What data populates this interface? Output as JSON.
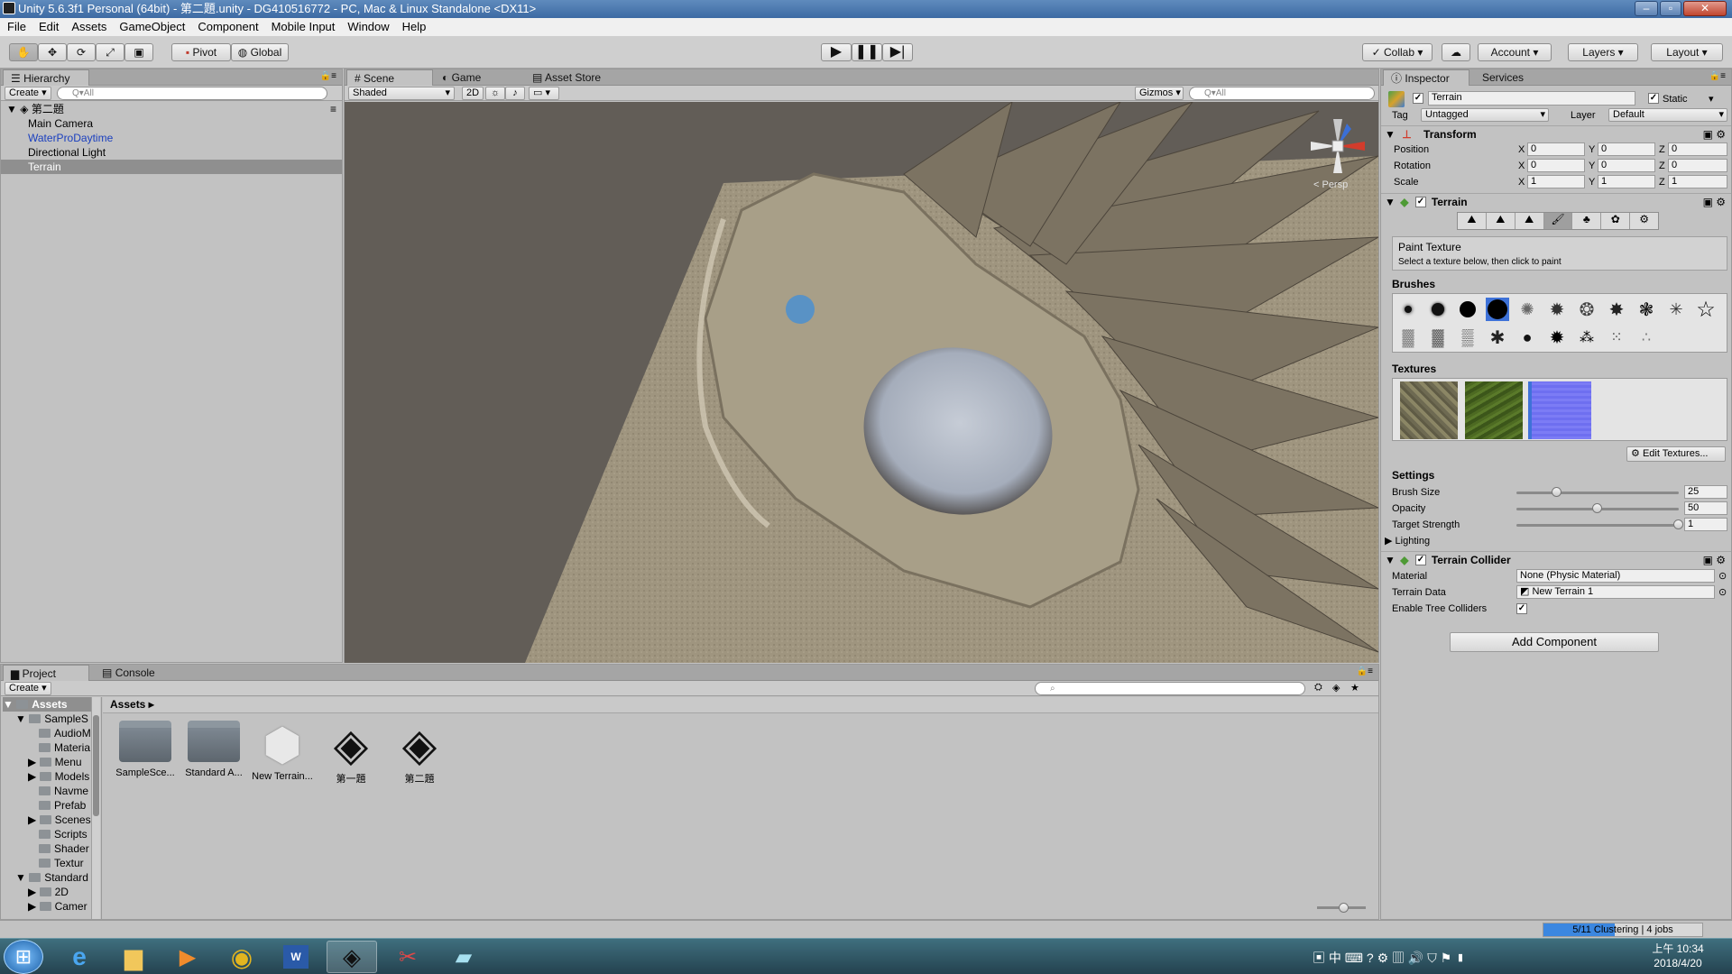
{
  "title": "Unity 5.6.3f1 Personal (64bit) - 第二題.unity - DG410516772 - PC, Mac & Linux Standalone <DX11>",
  "menu": [
    "File",
    "Edit",
    "Assets",
    "GameObject",
    "Component",
    "Mobile Input",
    "Window",
    "Help"
  ],
  "toolbar": {
    "pivot": "Pivot",
    "global": "Global",
    "collab": "Collab ▾",
    "account": "Account",
    "layers": "Layers",
    "layout": "Layout"
  },
  "hierarchy": {
    "tab": "Hierarchy",
    "create": "Create",
    "search_placeholder": "Q▾All",
    "scene": "第二題",
    "items": [
      {
        "label": "Main Camera",
        "prefab": false,
        "selected": false
      },
      {
        "label": "WaterProDaytime",
        "prefab": true,
        "selected": false
      },
      {
        "label": "Directional Light",
        "prefab": false,
        "selected": false
      },
      {
        "label": "Terrain",
        "prefab": false,
        "selected": true
      }
    ]
  },
  "scene_view": {
    "tabs": [
      "Scene",
      "Game",
      "Asset Store"
    ],
    "shading": "Shaded",
    "mode_2d": "2D",
    "gizmos": "Gizmos",
    "search_placeholder": "Q▾All",
    "persp": "< Persp"
  },
  "inspector": {
    "tabs": [
      "Inspector",
      "Services"
    ],
    "object_name": "Terrain",
    "static_label": "Static",
    "tag_label": "Tag",
    "tag_value": "Untagged",
    "layer_label": "Layer",
    "layer_value": "Default",
    "transform": {
      "title": "Transform",
      "rows": [
        {
          "label": "Position",
          "x": "0",
          "y": "0",
          "z": "0"
        },
        {
          "label": "Rotation",
          "x": "0",
          "y": "0",
          "z": "0"
        },
        {
          "label": "Scale",
          "x": "1",
          "y": "1",
          "z": "1"
        }
      ],
      "axis": [
        "X",
        "Y",
        "Z"
      ]
    },
    "terrain": {
      "title": "Terrain",
      "paint_title": "Paint Texture",
      "paint_hint": "Select a texture below, then click to paint",
      "brushes_label": "Brushes",
      "textures_label": "Textures",
      "edit_textures": "Edit Textures...",
      "settings_label": "Settings",
      "settings": [
        {
          "label": "Brush Size",
          "value": "25",
          "fraction": 0.25
        },
        {
          "label": "Opacity",
          "value": "50",
          "fraction": 0.5
        },
        {
          "label": "Target Strength",
          "value": "1",
          "fraction": 1.0
        }
      ],
      "lighting": "Lighting"
    },
    "collider": {
      "title": "Terrain Collider",
      "material_label": "Material",
      "material_value": "None (Physic Material)",
      "data_label": "Terrain Data",
      "data_value": "New Terrain 1",
      "trees_label": "Enable Tree Colliders"
    },
    "add_component": "Add Component"
  },
  "project": {
    "tabs": [
      "Project",
      "Console"
    ],
    "create": "Create",
    "tree": [
      {
        "label": "Assets",
        "bold": true
      },
      {
        "label": "SampleS"
      },
      {
        "label": "AudioM"
      },
      {
        "label": "Materia"
      },
      {
        "label": "Menu"
      },
      {
        "label": "Models"
      },
      {
        "label": "Navme"
      },
      {
        "label": "Prefab"
      },
      {
        "label": "Scenes"
      },
      {
        "label": "Scripts"
      },
      {
        "label": "Shader"
      },
      {
        "label": "Textur"
      },
      {
        "label": "Standard"
      },
      {
        "label": "2D"
      },
      {
        "label": "Camer"
      }
    ],
    "breadcrumb": "Assets",
    "assets": [
      {
        "label": "SampleSce...",
        "kind": "folder"
      },
      {
        "label": "Standard A...",
        "kind": "folder"
      },
      {
        "label": "New Terrain...",
        "kind": "terrain"
      },
      {
        "label": "第一題",
        "kind": "unity"
      },
      {
        "label": "第二題",
        "kind": "unity"
      }
    ]
  },
  "status": {
    "progress_text": "5/11 Clustering | 4 jobs",
    "progress_fraction": 0.45
  },
  "taskbar": {
    "time": "上午 10:34",
    "date": "2018/4/20",
    "ime": "中"
  }
}
